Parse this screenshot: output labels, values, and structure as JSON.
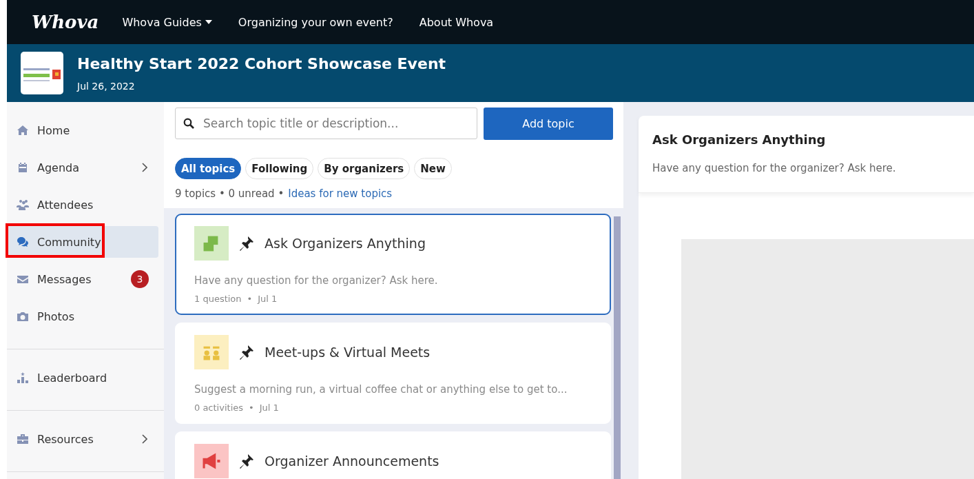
{
  "navbar": {
    "brand": "Whova",
    "links": [
      {
        "label": "Whova Guides",
        "dropdown": true
      },
      {
        "label": "Organizing your own event?",
        "dropdown": false
      },
      {
        "label": "About Whova",
        "dropdown": false
      }
    ]
  },
  "event": {
    "title": "Healthy Start 2022 Cohort Showcase Event",
    "date": "Jul 26, 2022"
  },
  "sidebar": {
    "sections": [
      [
        {
          "label": "Home",
          "selected": false,
          "highlighted": false
        },
        {
          "label": "Agenda",
          "selected": false,
          "highlighted": false,
          "expandable": true
        },
        {
          "label": "Attendees",
          "selected": false,
          "highlighted": false
        },
        {
          "label": "Community",
          "selected": true,
          "highlighted": true
        },
        {
          "label": "Messages",
          "selected": false,
          "highlighted": false,
          "badge": "3"
        },
        {
          "label": "Photos",
          "selected": false,
          "highlighted": false
        }
      ],
      [
        {
          "label": "Leaderboard",
          "selected": false,
          "highlighted": false
        }
      ],
      [
        {
          "label": "Resources",
          "selected": false,
          "highlighted": false,
          "expandable": true
        }
      ]
    ]
  },
  "search": {
    "placeholder": "Search topic title or description..."
  },
  "add_button": "Add topic",
  "filters": [
    {
      "label": "All topics",
      "selected": true
    },
    {
      "label": "Following",
      "selected": false
    },
    {
      "label": "By organizers",
      "selected": false
    },
    {
      "label": "New",
      "selected": false
    }
  ],
  "stats": {
    "text": "9 topics • 0 unread •",
    "link": "Ideas for new topics"
  },
  "meta_separator": "•",
  "topics": [
    {
      "title": "Ask Organizers Anything",
      "pinned": true,
      "selected": true,
      "color": "#d6ecc4",
      "description": "Have any question for the organizer? Ask here.",
      "count": "1 question",
      "date": "Jul 1"
    },
    {
      "title": "Meet-ups & Virtual Meets",
      "pinned": true,
      "selected": false,
      "color": "#fcefc0",
      "description": "Suggest a morning run, a virtual coffee chat or anything else to get to...",
      "count": "0 activities",
      "date": "Jul 1"
    },
    {
      "title": "Organizer Announcements",
      "pinned": true,
      "selected": false,
      "color": "#fbc4c4"
    }
  ],
  "detail": {
    "title": "Ask Organizers Anything",
    "description": "Have any question for the organizer? Ask here."
  }
}
